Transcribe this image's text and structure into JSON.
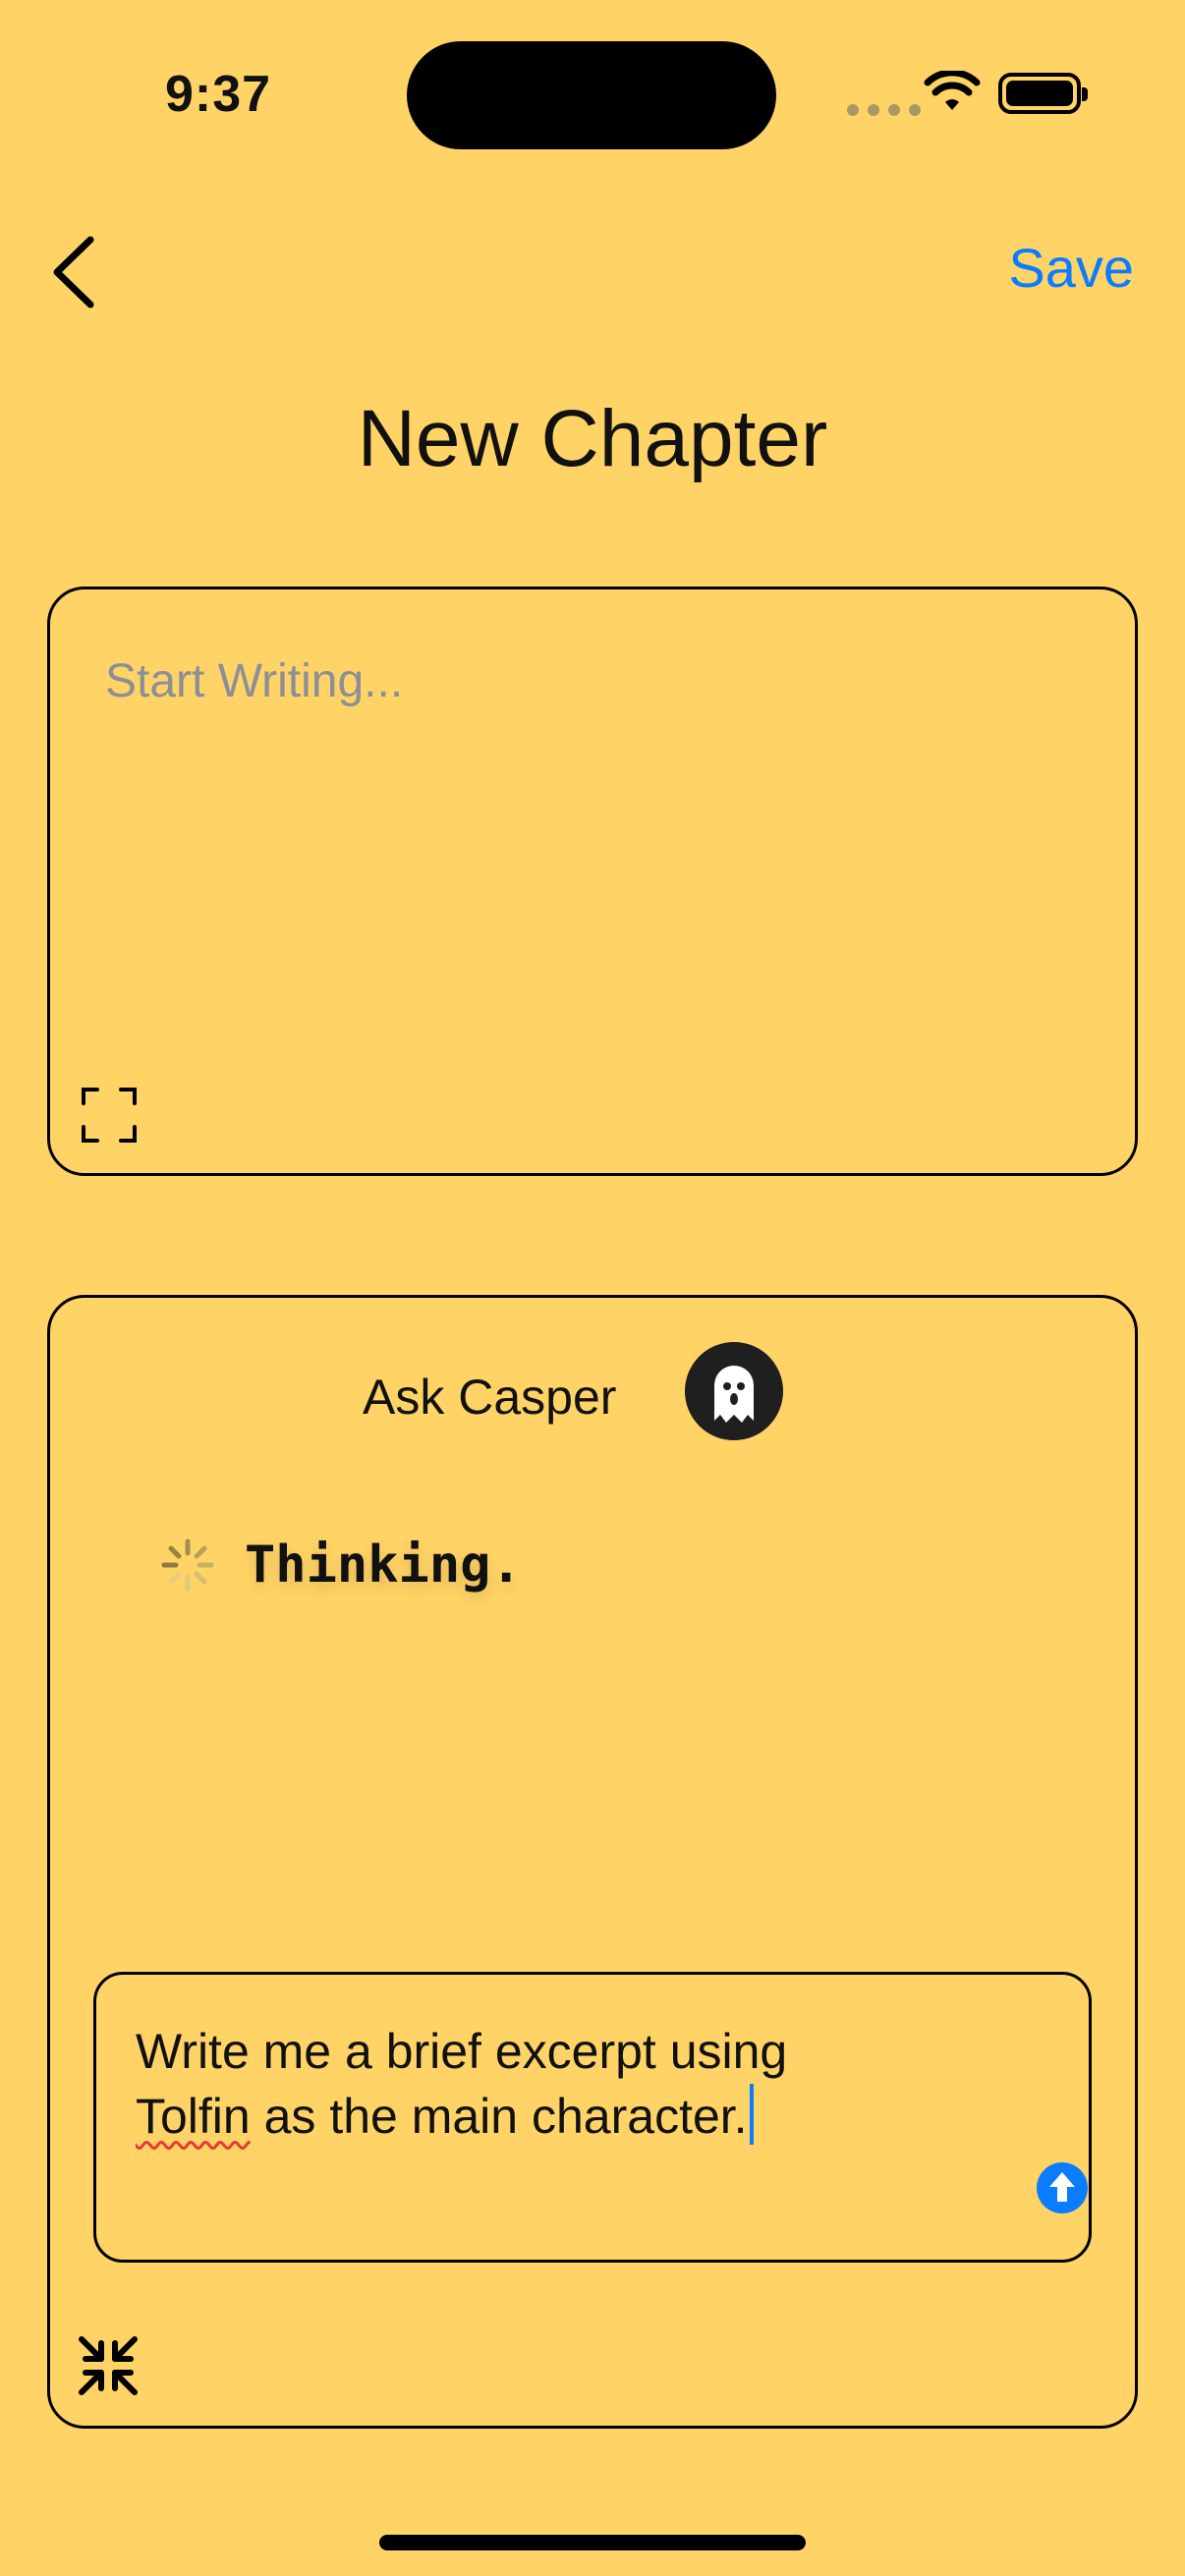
{
  "status_bar": {
    "time": "9:37"
  },
  "nav": {
    "save_label": "Save",
    "title": "New Chapter"
  },
  "editor": {
    "placeholder": "Start Writing..."
  },
  "casper": {
    "label": "Ask Casper",
    "status": "Thinking.",
    "prompt_line1_a": "Write me a brief excerpt using",
    "prompt_line2_word": "Tolfin",
    "prompt_line2_rest": " as the main character."
  },
  "colors": {
    "background": "#FFD365",
    "accent": "#0A7CFF"
  }
}
